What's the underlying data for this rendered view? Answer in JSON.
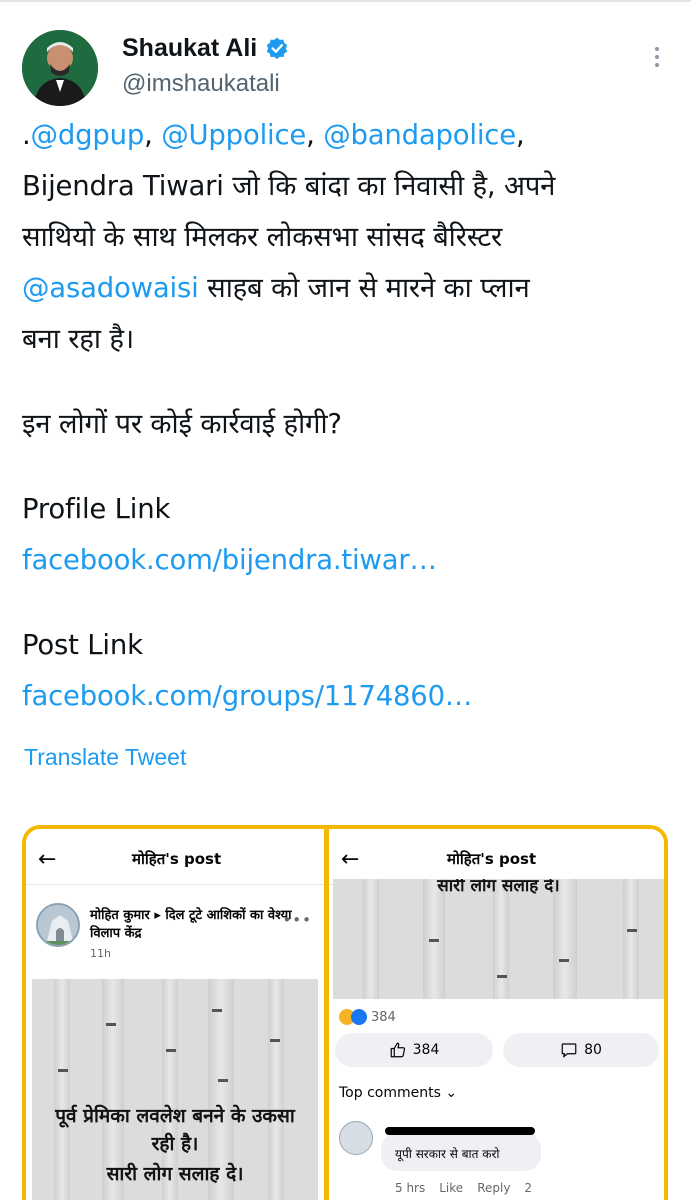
{
  "tweet": {
    "author": {
      "display_name": "Shaukat Ali",
      "handle": "@imshaukatali",
      "verified": true
    },
    "text": {
      "line1_prefix": ".",
      "mention_dgpup": "@dgpup",
      "sep1": ", ",
      "mention_uppolice": "@Uppolice",
      "sep2": ", ",
      "mention_bandapolice": "@bandapolice",
      "sep3": ",",
      "line2": "Bijendra Tiwari जो कि बांदा का निवासी है, अपने",
      "line3": "साथियो के साथ मिलकर लोकसभा सांसद बैरिस्टर",
      "mention_asadowaisi": "@asadowaisi",
      "line4_suffix": " साहब को जान से मारने का प्लान",
      "line5": "बना रहा है।",
      "question": "इन लोगों पर कोई कार्रवाई होगी?",
      "profile_label": "Profile Link",
      "profile_url": "facebook.com/bijendra.tiwar…",
      "post_label": "Post Link",
      "post_url": "facebook.com/groups/1174860…"
    },
    "translate_label": "Translate Tweet"
  },
  "media": {
    "left": {
      "back_icon": "←",
      "title": "मोहित's post",
      "author_name": "मोहित कुमार ▸ दिल टूटे आशिकों का वेश्या विलाप केंद्र",
      "time": "11h",
      "menu_dots": "•••",
      "image_text_line1": "पूर्व प्रेमिका लवलेश बनने के उकसा",
      "image_text_line2": "रही है।",
      "image_text_line3": "सारी लोग सलाह दे।"
    },
    "right": {
      "back_icon": "←",
      "title": "मोहित's post",
      "image_text_top": "सारी लोग सलाह दे।",
      "reaction_count": "384",
      "like_count": "384",
      "comment_count": "80",
      "top_comments_label": "Top comments",
      "comment_text": "यूपी सरकार से बात करो",
      "comment_time": "5 hrs",
      "comment_like": "Like",
      "comment_reply": "Reply",
      "comment_reactions": "2"
    }
  },
  "colors": {
    "link": "#1d9bf0",
    "verified": "#1d9bf0",
    "media_border": "#f5b800",
    "text": "#0f1419",
    "secondary": "#536471"
  }
}
